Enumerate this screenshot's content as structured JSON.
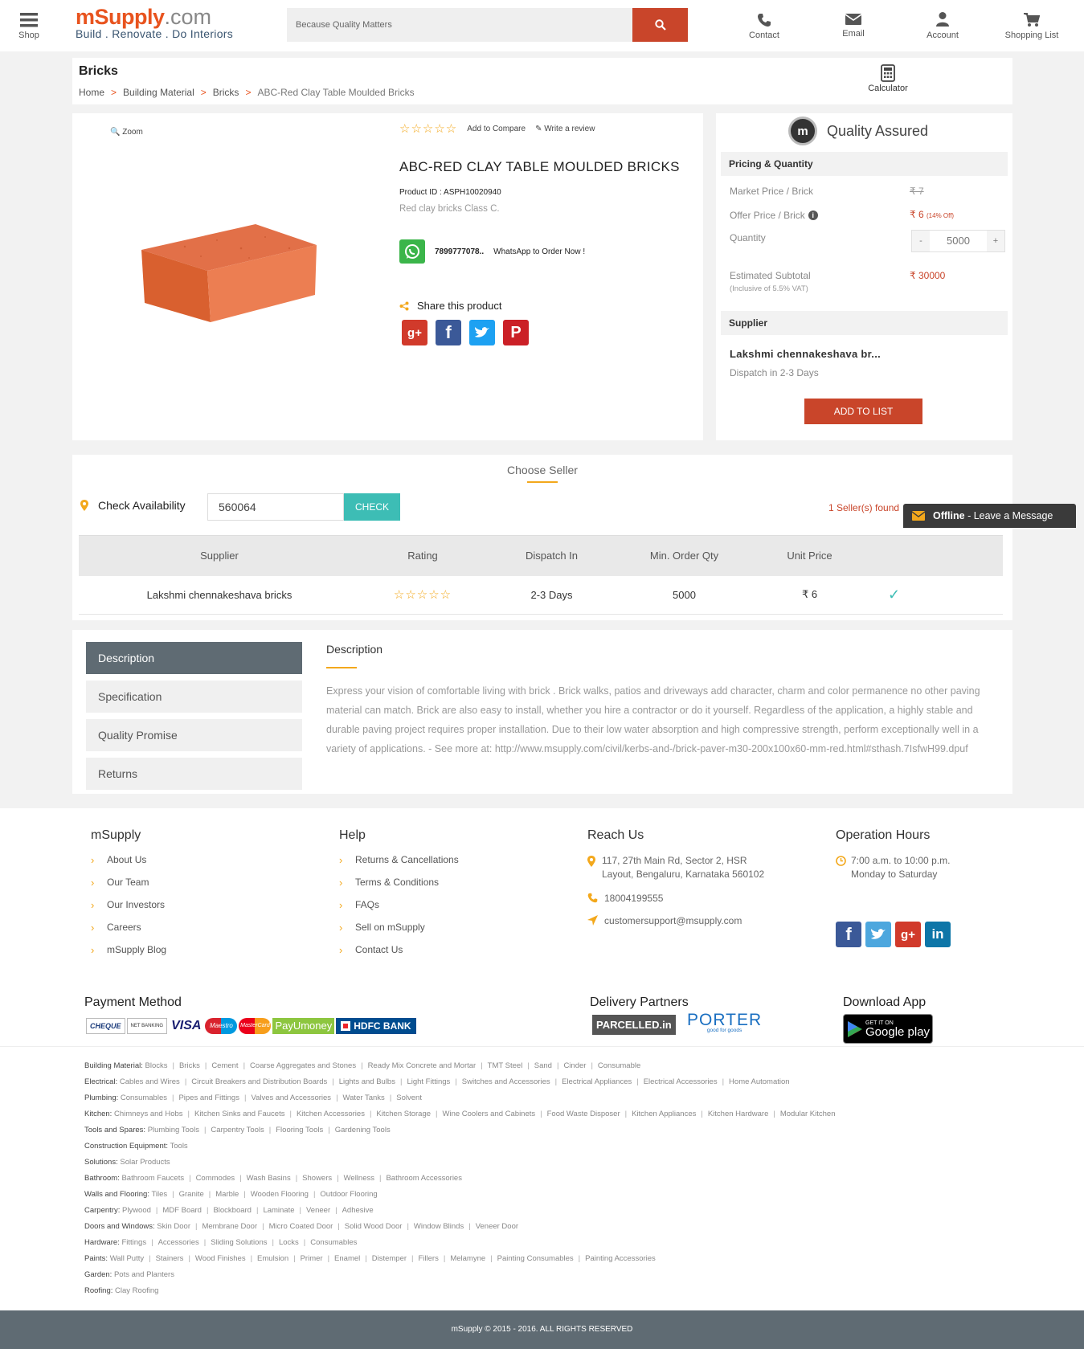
{
  "header": {
    "shop": "Shop",
    "logo_main": "mSupply",
    "logo_suffix": ".com",
    "tagline": "Build . Renovate . Do Interiors",
    "search_placeholder": "Because Quality Matters",
    "contact": "Contact",
    "email": "Email",
    "account": "Account",
    "shopping_list": "Shopping List"
  },
  "page": {
    "title": "Bricks",
    "breadcrumb": [
      "Home",
      "Building Material",
      "Bricks",
      "ABC-Red Clay Table Moulded Bricks"
    ],
    "calculator": "Calculator"
  },
  "product": {
    "zoom": "Zoom",
    "add_compare": "Add to Compare",
    "write_review": "Write a review",
    "name": "ABC-RED CLAY TABLE MOULDED BRICKS",
    "product_id": "Product ID : ASPH10020940",
    "subtitle": "Red clay bricks Class C.",
    "whatsapp_number": "7899777078..",
    "whatsapp_text": "WhatsApp to Order Now !",
    "share": "Share this product"
  },
  "pricing": {
    "quality": "Quality Assured",
    "section": "Pricing & Quantity",
    "market_label": "Market Price / Brick",
    "market_value": "₹ 7",
    "offer_label": "Offer Price / Brick",
    "offer_value": "₹ 6",
    "offer_pct": "(14% Off)",
    "qty_label": "Quantity",
    "qty_minus": "-",
    "qty_value": "5000",
    "qty_plus": "+",
    "subtotal_label": "Estimated Subtotal",
    "subtotal_note": "(Inclusive of 5.5% VAT)",
    "subtotal_value": "₹ 30000",
    "supplier_section": "Supplier",
    "supplier_name": "Lakshmi chennakeshava br...",
    "dispatch": "Dispatch in 2-3 Days",
    "add_to_list": "ADD TO LIST"
  },
  "seller": {
    "title": "Choose Seller",
    "check_label": "Check Availability",
    "pincode": "560064",
    "check_btn": "CHECK",
    "found": "1 Seller(s) found",
    "columns": [
      "Supplier",
      "Rating",
      "Dispatch In",
      "Min. Order Qty",
      "Unit Price"
    ],
    "row": {
      "supplier": "Lakshmi chennakeshava bricks",
      "dispatch": "2-3 Days",
      "moq": "5000",
      "price": "₹ 6"
    }
  },
  "chat": {
    "status": "Offline",
    "text": " - Leave a Message"
  },
  "tabs": [
    "Description",
    "Specification",
    "Quality Promise",
    "Returns"
  ],
  "description": {
    "title": "Description",
    "text": "Express your vision of comfortable living with brick . Brick walks, patios and driveways add character, charm and color permanence no other paving material can match. Brick are also easy to install, whether you hire a contractor or do it yourself. Regardless of the application, a highly stable and durable paving project requires proper installation. Due to their low water absorption and high compressive strength, perform exceptionally well in a variety of applications. - See more at: http://www.msupply.com/civil/kerbs-and-/brick-paver-m30-200x100x60-mm-red.html#sthash.7IsfwH99.dpuf"
  },
  "footer": {
    "msupply": {
      "title": "mSupply",
      "links": [
        "About Us",
        "Our Team",
        "Our Investors",
        "Careers",
        "mSupply Blog"
      ]
    },
    "help": {
      "title": "Help",
      "links": [
        "Returns & Cancellations",
        "Terms & Conditions",
        "FAQs",
        "Sell on mSupply",
        "Contact Us"
      ]
    },
    "reach": {
      "title": "Reach Us",
      "address1": "117, 27th Main Rd, Sector 2, HSR",
      "address2": "Layout, Bengaluru, Karnataka 560102",
      "phone": "18004199555",
      "email": "customersupport@msupply.com"
    },
    "hours": {
      "title": "Operation Hours",
      "time": "7:00 a.m. to 10:00 p.m.",
      "days": "Monday to Saturday"
    },
    "payment_title": "Payment Method",
    "payment": {
      "cheque": "CHEQUE",
      "net": "NET BANKING",
      "visa": "VISA",
      "maestro": "Maestro",
      "mastercard": "MasterCard",
      "payu": "PayUmoney",
      "hdfc": "HDFC BANK"
    },
    "delivery_title": "Delivery Partners",
    "parcelled": "PARCELLED.in",
    "porter": "PORTER",
    "porter_tag": "good for goods",
    "app_title": "Download App",
    "gp_small": "GET IT ON",
    "gp_big": "Google play",
    "copyright": "mSupply © 2015 - 2016. ALL RIGHTS RESERVED"
  },
  "categories": [
    {
      "head": "Building Material:",
      "items": [
        "Blocks",
        "Bricks",
        "Cement",
        "Coarse Aggregates and Stones",
        "Ready Mix Concrete and Mortar",
        "TMT Steel",
        "Sand",
        "Cinder",
        "Consumable"
      ]
    },
    {
      "head": "Electrical:",
      "items": [
        "Cables and Wires",
        "Circuit Breakers and Distribution Boards",
        "Lights and Bulbs",
        "Light Fittings",
        "Switches and Accessories",
        "Electrical Appliances",
        "Electrical Accessories",
        "Home Automation"
      ]
    },
    {
      "head": "Plumbing:",
      "items": [
        "Consumables",
        "Pipes and Fittings",
        "Valves and Accessories",
        "Water Tanks",
        "Solvent"
      ]
    },
    {
      "head": "Kitchen:",
      "items": [
        "Chimneys and Hobs",
        "Kitchen Sinks and Faucets",
        "Kitchen Accessories",
        "Kitchen Storage",
        "Wine Coolers and Cabinets",
        "Food Waste Disposer",
        "Kitchen Appliances",
        "Kitchen Hardware",
        "Modular Kitchen"
      ]
    },
    {
      "head": "Tools and Spares:",
      "items": [
        "Plumbing Tools",
        "Carpentry Tools",
        "Flooring Tools",
        "Gardening Tools"
      ]
    },
    {
      "head": "Construction Equipment:",
      "items": [
        "Tools"
      ]
    },
    {
      "head": "Solutions:",
      "items": [
        "Solar Products"
      ]
    },
    {
      "head": "Bathroom:",
      "items": [
        "Bathroom Faucets",
        "Commodes",
        "Wash Basins",
        "Showers",
        "Wellness",
        "Bathroom Accessories"
      ]
    },
    {
      "head": "Walls and Flooring:",
      "items": [
        "Tiles",
        "Granite",
        "Marble",
        "Wooden Flooring",
        "Outdoor Flooring"
      ]
    },
    {
      "head": "Carpentry:",
      "items": [
        "Plywood",
        "MDF Board",
        "Blockboard",
        "Laminate",
        "Veneer",
        "Adhesive"
      ]
    },
    {
      "head": "Doors and Windows:",
      "items": [
        "Skin Door",
        "Membrane Door",
        "Micro Coated Door",
        "Solid Wood Door",
        "Window Blinds",
        "Veneer Door"
      ]
    },
    {
      "head": "Hardware:",
      "items": [
        "Fittings",
        "Accessories",
        "Sliding Solutions",
        "Locks",
        "Consumables"
      ]
    },
    {
      "head": "Paints:",
      "items": [
        "Wall Putty",
        "Stainers",
        "Wood Finishes",
        "Emulsion",
        "Primer",
        "Enamel",
        "Distemper",
        "Fillers",
        "Melamyne",
        "Painting Consumables",
        "Painting Accessories"
      ]
    },
    {
      "head": "Garden:",
      "items": [
        "Pots and Planters"
      ]
    },
    {
      "head": "Roofing:",
      "items": [
        "Clay Roofing"
      ]
    }
  ],
  "colors": {
    "accent": "#c9452a",
    "teal": "#3dbdb5",
    "star": "#f3a81c",
    "dark": "#5f6b73"
  }
}
